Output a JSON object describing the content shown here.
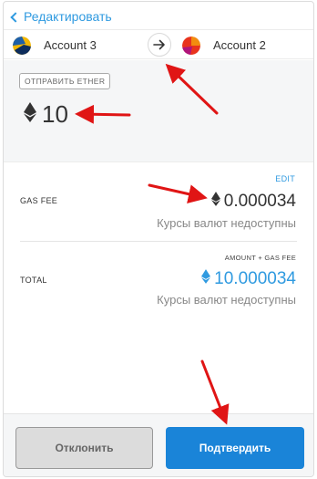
{
  "header": {
    "back_label": "Редактировать"
  },
  "accounts": {
    "from": {
      "name": "Account 3"
    },
    "to": {
      "name": "Account 2"
    }
  },
  "send": {
    "badge": "ОТПРАВИТЬ ETHER",
    "amount": "10"
  },
  "fees": {
    "edit_label": "EDIT",
    "gas_label": "GAS FEE",
    "gas_value": "0.000034",
    "gas_fiat": "Курсы валют недоступны",
    "amount_plus_gas_label": "AMOUNT + GAS FEE",
    "total_label": "TOTAL",
    "total_value": "10.000034",
    "total_fiat": "Курсы валют недоступны"
  },
  "footer": {
    "reject_label": "Отклонить",
    "confirm_label": "Подтвердить"
  },
  "colors": {
    "accent": "#2f9ae0",
    "confirm_button": "#1a84d8",
    "annotation_arrow": "#e01515"
  }
}
